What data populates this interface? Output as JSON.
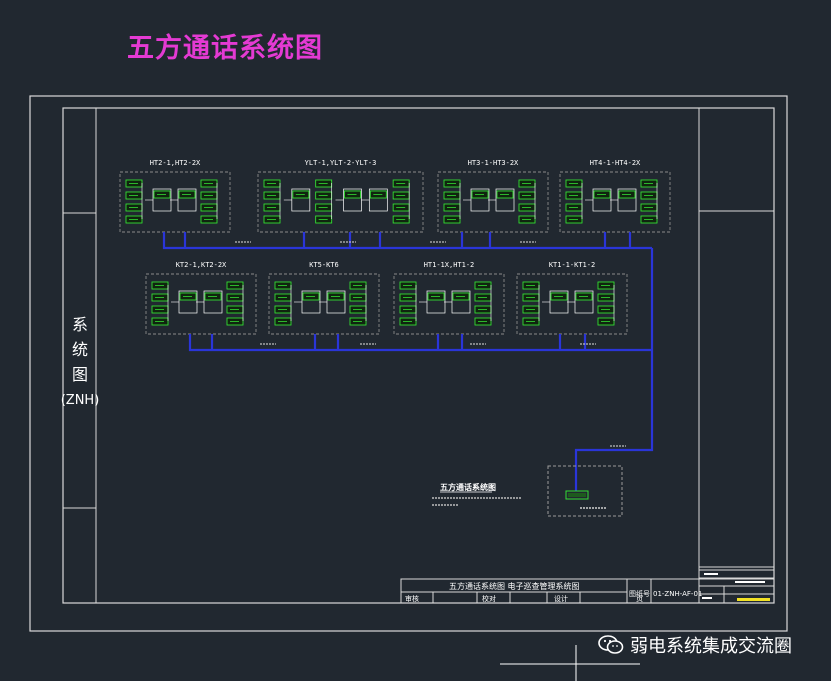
{
  "title": "五方通话系统图",
  "side_label": {
    "lines": [
      "系",
      "统",
      "图"
    ],
    "code": "(ZNH)"
  },
  "groups_row1": [
    {
      "label": "HT2-1,HT2-2X"
    },
    {
      "label": "YLT-1,YLT-2-YLT-3"
    },
    {
      "label": "HT3-1-HT3-2X"
    },
    {
      "label": "HT4-1-HT4-2X"
    }
  ],
  "groups_row2": [
    {
      "label": "KT2-1,KT2-2X"
    },
    {
      "label": "KT5-KT6"
    },
    {
      "label": "HT1-1X,HT1-2"
    },
    {
      "label": "KT1-1-KT1-2"
    }
  ],
  "legend": {
    "title": "五方通话系统图"
  },
  "title_block": {
    "drawing_title": "五方通话系统图  电子巡查管理系统图",
    "drawing_no_label": "图纸号",
    "drawing_no": "01-ZNH-AF-01",
    "role_1": "审核",
    "role_2": "校对",
    "role_3": "设计",
    "page_label": "页"
  },
  "watermark": {
    "text": "弱电系统集成交流圈"
  },
  "colors": {
    "background": "#212830",
    "frame": "#d9d9d9",
    "bus": "#2a35d8",
    "device": "#33dd33",
    "title": "#e43ad3"
  }
}
